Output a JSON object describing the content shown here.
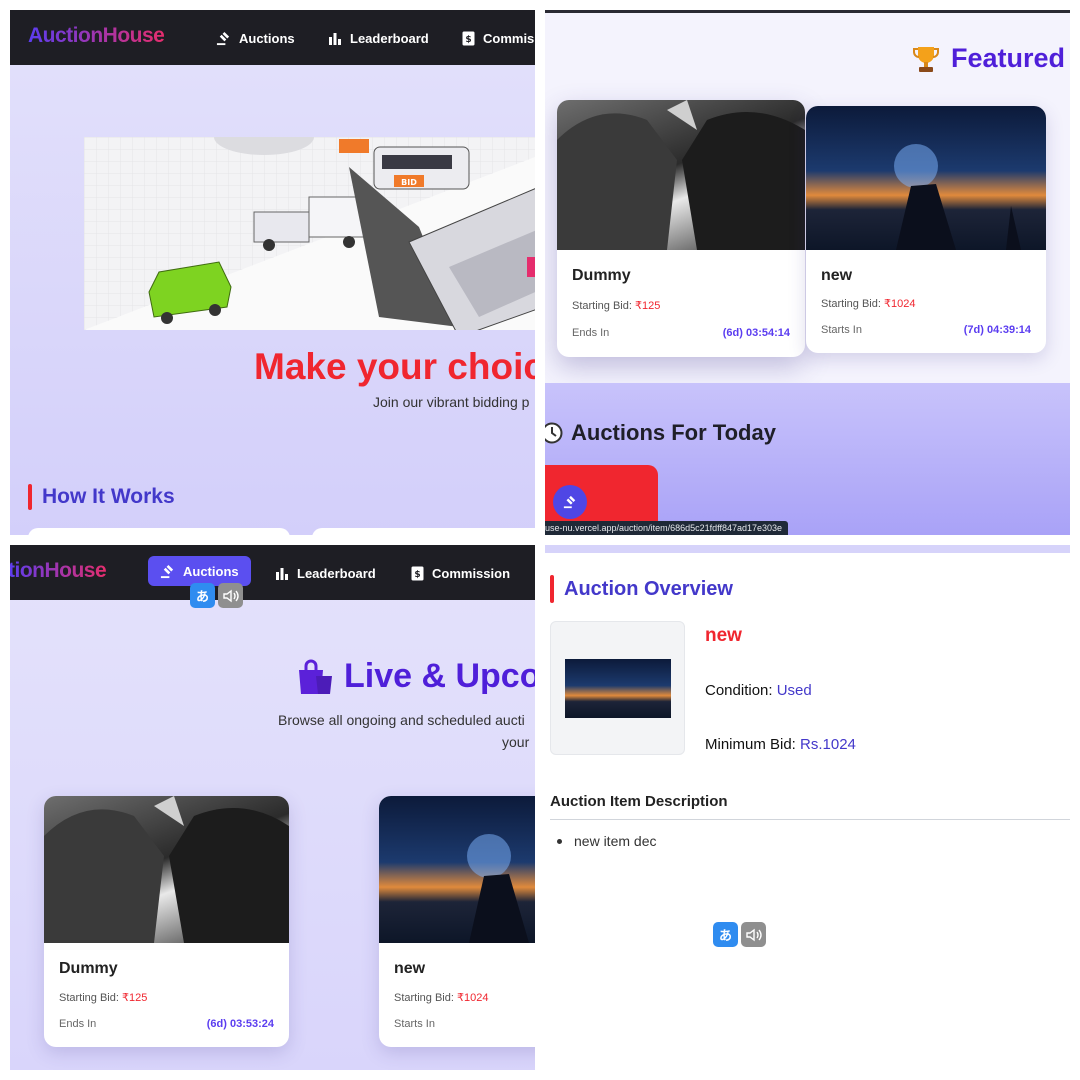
{
  "nav": {
    "logo": "AuctionHouse",
    "logo_cropped": "tionHouse",
    "items": [
      {
        "label": "Auctions"
      },
      {
        "label": "Leaderboard"
      },
      {
        "label": "Commission"
      }
    ],
    "commission_cropped": "Commis"
  },
  "home": {
    "hero_title": "Make your choic",
    "hero_subtitle": "Join our vibrant bidding p",
    "how_it_works": "How It Works",
    "bid_sign": "BID"
  },
  "featured": {
    "heading": "Featured A",
    "cards": [
      {
        "title": "Dummy",
        "bid_label": "Starting Bid:",
        "bid_value": "₹125",
        "time_label": "Ends In",
        "timer": "(6d) 03:54:14"
      },
      {
        "title": "new",
        "bid_label": "Starting Bid:",
        "bid_value": "₹1024",
        "time_label": "Starts In",
        "timer": "(7d) 04:39:14"
      }
    ],
    "today_heading": "Auctions For Today",
    "status_url": "use-nu.vercel.app/auction/item/686d5c21fdff847ad17e303e"
  },
  "live": {
    "heading": "Live & Upco",
    "subtitle_line1": "Browse all ongoing and scheduled aucti",
    "subtitle_line2": "your",
    "cards": [
      {
        "title": "Dummy",
        "bid_label": "Starting Bid:",
        "bid_value": "₹125",
        "time_label": "Ends In",
        "timer": "(6d) 03:53:24"
      },
      {
        "title": "new",
        "bid_label": "Starting Bid:",
        "bid_value": "₹1024",
        "time_label": "Starts In",
        "timer": ""
      }
    ]
  },
  "overview": {
    "heading": "Auction Overview",
    "item_name": "new",
    "condition_label": "Condition:",
    "condition_value": "Used",
    "min_bid_label": "Minimum Bid:",
    "min_bid_value": "Rs.1024",
    "description_heading": "Auction Item Description",
    "description_items": [
      "new item dec"
    ]
  },
  "translate": {
    "jp_glyph": "あ",
    "latin_glyph": "a"
  },
  "colors": {
    "brand_purple": "#4f1fd9",
    "accent_red": "#f0262f",
    "nav_bg": "#1e1e24",
    "active_nav": "#5b4ff0",
    "timer": "#5b3df0"
  }
}
